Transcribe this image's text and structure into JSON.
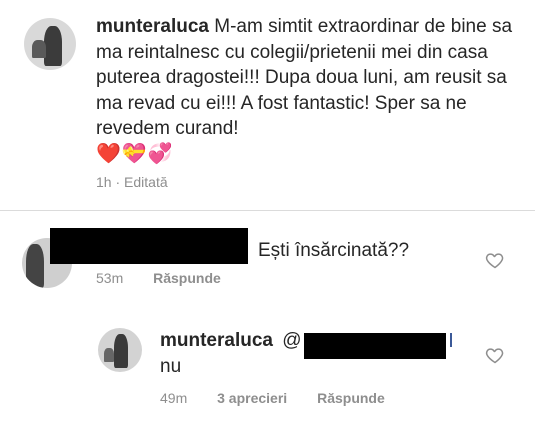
{
  "caption": {
    "username": "munteraluca",
    "text": "M-am simtit extraordinar de bine sa ma reintalnesc cu colegii/prietenii mei din casa puterea dragostei!!! Dupa doua luni, am reusit sa ma revad cu ei!!! A fost fantastic! Sper sa ne revedem curand!",
    "emojis": "❤️💝💞",
    "time": "1h",
    "separator": "·",
    "edited": "Editată"
  },
  "comment1": {
    "text": "Ești însărcinată??",
    "time": "53m",
    "reply_label": "Răspunde"
  },
  "reply": {
    "username": "munteraluca",
    "mention_prefix": "@",
    "text": "nu",
    "time": "49m",
    "likes": "3 aprecieri",
    "reply_label": "Răspunde"
  },
  "colors": {
    "text": "#262626",
    "secondary": "#8e8e8e",
    "divider": "#dbdbdb",
    "heart": "#d8102c"
  },
  "icons": {
    "like": "heart-outline-icon"
  }
}
